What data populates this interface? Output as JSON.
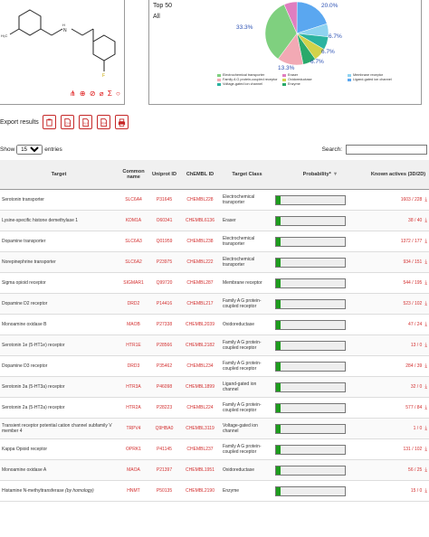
{
  "structure_icons": "⋔ ⊕ ⊘ ⌀ Σ ○",
  "pie": {
    "headers": [
      "Top 50",
      "All"
    ],
    "labels": {
      "electro": "33.3%",
      "eraser": "20.0%",
      "blue": "6.7%",
      "cyan": "6.7%",
      "yellow": "6.7%",
      "pink": "13.3%"
    },
    "slices": [
      {
        "name": "Electrochemical transporter",
        "pct": 33.3,
        "color": "#7fd07f"
      },
      {
        "name": "Family A G protein-coupled receptor",
        "pct": 13.3,
        "color": "#f2a9b4"
      },
      {
        "name": "Voltage-gated ion channel",
        "pct": 6.7,
        "color": "#2bb3a0"
      },
      {
        "name": "Eraser",
        "pct": 6.7,
        "color": "#e07ec0"
      },
      {
        "name": "Oxidoreductase",
        "pct": 6.7,
        "color": "#d2d24a"
      },
      {
        "name": "Enzyme",
        "pct": 6.7,
        "color": "#2aa96b"
      },
      {
        "name": "Membrane receptor",
        "pct": 6.7,
        "color": "#8fd3f0"
      },
      {
        "name": "Ligand-gated ion channel",
        "pct": 20.0,
        "color": "#5aa7f0"
      }
    ]
  },
  "export": {
    "label": "Export results"
  },
  "show": {
    "prefix": "Show",
    "value": "15",
    "suffix": "entries"
  },
  "search": {
    "label": "Search:",
    "placeholder": ""
  },
  "columns": [
    "Target",
    "Common name",
    "Uniprot ID",
    "ChEMBL ID",
    "Target Class",
    "Probability*",
    "Known actives (3D/2D)"
  ],
  "rows": [
    {
      "target": "Serotonin transporter",
      "common": "SLC6A4",
      "uniprot": "P31645",
      "chembl": "CHEMBL228",
      "cls": "Electrochemical transporter",
      "prob": 0.06,
      "actives": "1603 / 228"
    },
    {
      "target": "Lysine-specific histone demethylase 1",
      "common": "KDM1A",
      "uniprot": "O60341",
      "chembl": "CHEMBL6136",
      "cls": "Eraser",
      "prob": 0.06,
      "actives": "38 / 40"
    },
    {
      "target": "Dopamine transporter",
      "common": "SLC6A3",
      "uniprot": "Q01959",
      "chembl": "CHEMBL238",
      "cls": "Electrochemical transporter",
      "prob": 0.06,
      "actives": "1372 / 177"
    },
    {
      "target": "Norepinephrine transporter",
      "common": "SLC6A2",
      "uniprot": "P23975",
      "chembl": "CHEMBL222",
      "cls": "Electrochemical transporter",
      "prob": 0.06,
      "actives": "934 / 151"
    },
    {
      "target": "Sigma opioid receptor",
      "common": "SIGMAR1",
      "uniprot": "Q99720",
      "chembl": "CHEMBL287",
      "cls": "Membrane receptor",
      "prob": 0.06,
      "actives": "544 / 195"
    },
    {
      "target": "Dopamine D2 receptor",
      "common": "DRD2",
      "uniprot": "P14416",
      "chembl": "CHEMBL217",
      "cls": "Family A G protein-coupled receptor",
      "prob": 0.06,
      "actives": "523 / 102"
    },
    {
      "target": "Monoamine oxidase B",
      "common": "MAOB",
      "uniprot": "P27338",
      "chembl": "CHEMBL2039",
      "cls": "Oxidoreductase",
      "prob": 0.06,
      "actives": "47 / 24"
    },
    {
      "target": "Serotonin 1e (5-HT1e) receptor",
      "common": "HTR1E",
      "uniprot": "P28566",
      "chembl": "CHEMBL2182",
      "cls": "Family A G protein-coupled receptor",
      "prob": 0.06,
      "actives": "13 / 0"
    },
    {
      "target": "Dopamine D3 receptor",
      "common": "DRD3",
      "uniprot": "P35462",
      "chembl": "CHEMBL234",
      "cls": "Family A G protein-coupled receptor",
      "prob": 0.06,
      "actives": "284 / 39"
    },
    {
      "target": "Serotonin 3a (5-HT3a) receptor",
      "common": "HTR3A",
      "uniprot": "P46098",
      "chembl": "CHEMBL1899",
      "cls": "Ligand-gated ion channel",
      "prob": 0.06,
      "actives": "32 / 0"
    },
    {
      "target": "Serotonin 2a (5-HT2a) receptor",
      "common": "HTR2A",
      "uniprot": "P28223",
      "chembl": "CHEMBL224",
      "cls": "Family A G protein-coupled receptor",
      "prob": 0.06,
      "actives": "577 / 84"
    },
    {
      "target": "Transient receptor potential cation channel subfamily V member 4",
      "common": "TRPV4",
      "uniprot": "Q9HBA0",
      "chembl": "CHEMBL3119",
      "cls": "Voltage-gated ion channel",
      "prob": 0.06,
      "actives": "1 / 0"
    },
    {
      "target": "Kappa Opioid receptor",
      "common": "OPRK1",
      "uniprot": "P41145",
      "chembl": "CHEMBL237",
      "cls": "Family A G protein-coupled receptor",
      "prob": 0.06,
      "actives": "131 / 102"
    },
    {
      "target": "Monoamine oxidase A",
      "common": "MAOA",
      "uniprot": "P21397",
      "chembl": "CHEMBL1951",
      "cls": "Oxidoreductase",
      "prob": 0.06,
      "actives": "56 / 25"
    },
    {
      "target": "Histamine N-methyltransferase",
      "target_note": "(by homology)",
      "common": "HNMT",
      "uniprot": "P50135",
      "chembl": "CHEMBL2190",
      "cls": "Enzyme",
      "prob": 0.06,
      "actives": "15 / 0"
    }
  ]
}
